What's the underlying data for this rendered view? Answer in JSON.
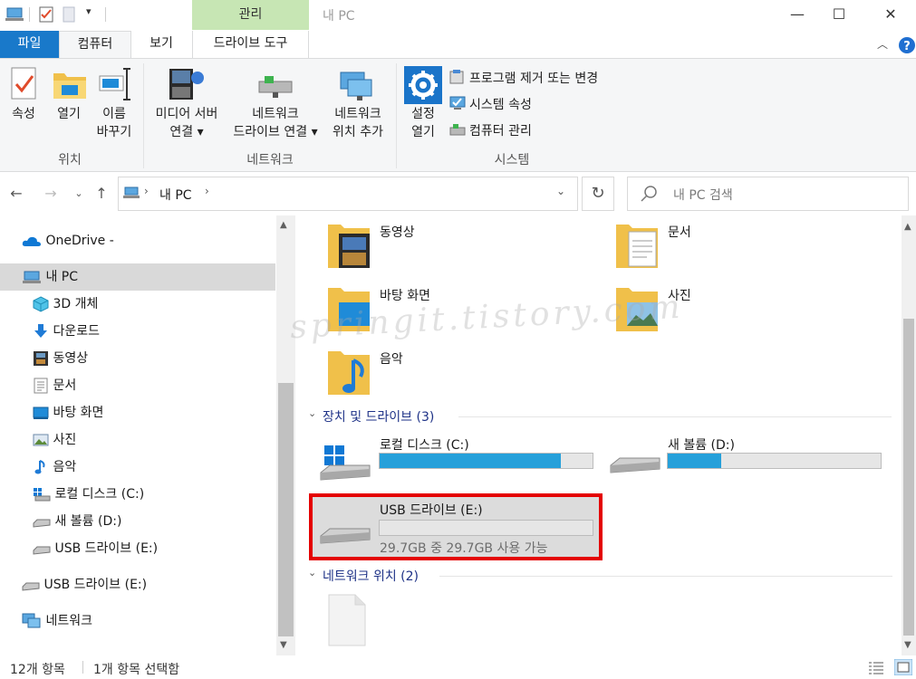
{
  "window": {
    "title": "내 PC",
    "manage_tab": "관리",
    "minimize": "—",
    "maximize": "☐",
    "close": "✕"
  },
  "tabs": {
    "file": "파일",
    "computer": "컴퓨터",
    "view": "보기",
    "drive_tools": "드라이브 도구"
  },
  "ribbon": {
    "location": {
      "properties": "속성",
      "open": "열기",
      "rename_1": "이름",
      "rename_2": "바꾸기",
      "group": "위치"
    },
    "network": {
      "media_1": "미디어 서버",
      "media_2": "연결 ▾",
      "map_1": "네트워크",
      "map_2": "드라이브 연결 ▾",
      "add_1": "네트워크",
      "add_2": "위치 추가",
      "group": "네트워크"
    },
    "system": {
      "settings_1": "설정",
      "settings_2": "열기",
      "uninstall": "프로그램 제거 또는 변경",
      "properties": "시스템 속성",
      "manage": "컴퓨터 관리",
      "group": "시스템"
    }
  },
  "address": {
    "path": "내 PC",
    "search_placeholder": "내 PC 검색"
  },
  "nav": {
    "items": [
      {
        "label": "OneDrive -",
        "icon": "cloud-icon"
      },
      {
        "label": "내 PC",
        "icon": "pc-icon"
      },
      {
        "label": "3D 개체",
        "icon": "cube-icon"
      },
      {
        "label": "다운로드",
        "icon": "download-icon"
      },
      {
        "label": "동영상",
        "icon": "video-icon"
      },
      {
        "label": "문서",
        "icon": "document-icon"
      },
      {
        "label": "바탕 화면",
        "icon": "desktop-icon"
      },
      {
        "label": "사진",
        "icon": "picture-icon"
      },
      {
        "label": "음악",
        "icon": "music-icon"
      },
      {
        "label": "로컬 디스크 (C:)",
        "icon": "windows-drive-icon"
      },
      {
        "label": "새 볼륨 (D:)",
        "icon": "drive-icon"
      },
      {
        "label": "USB 드라이브 (E:)",
        "icon": "drive-icon"
      },
      {
        "label": "USB 드라이브 (E:)",
        "icon": "drive-icon"
      },
      {
        "label": "네트워크",
        "icon": "network-icon"
      }
    ]
  },
  "folders": [
    "동영상",
    "문서",
    "바탕 화면",
    "사진",
    "음악"
  ],
  "sections": {
    "devices": "장치 및 드라이브 (3)",
    "network": "네트워크 위치 (2)"
  },
  "drives": {
    "c": {
      "label": "로컬 디스크 (C:)",
      "used_fraction": 0.85
    },
    "d": {
      "label": "새 볼륨 (D:)",
      "used_fraction": 0.25
    },
    "e": {
      "label": "USB 드라이브 (E:)",
      "free_text": "29.7GB 중 29.7GB 사용 가능",
      "used_fraction": 0.0
    }
  },
  "watermark": "springit.tistory.com",
  "status": {
    "count": "12개 항목",
    "selected": "1개 항목 선택함"
  },
  "colors": {
    "accent": "#1979ca",
    "bar": "#26a0da",
    "highlight_border": "#e40000"
  }
}
